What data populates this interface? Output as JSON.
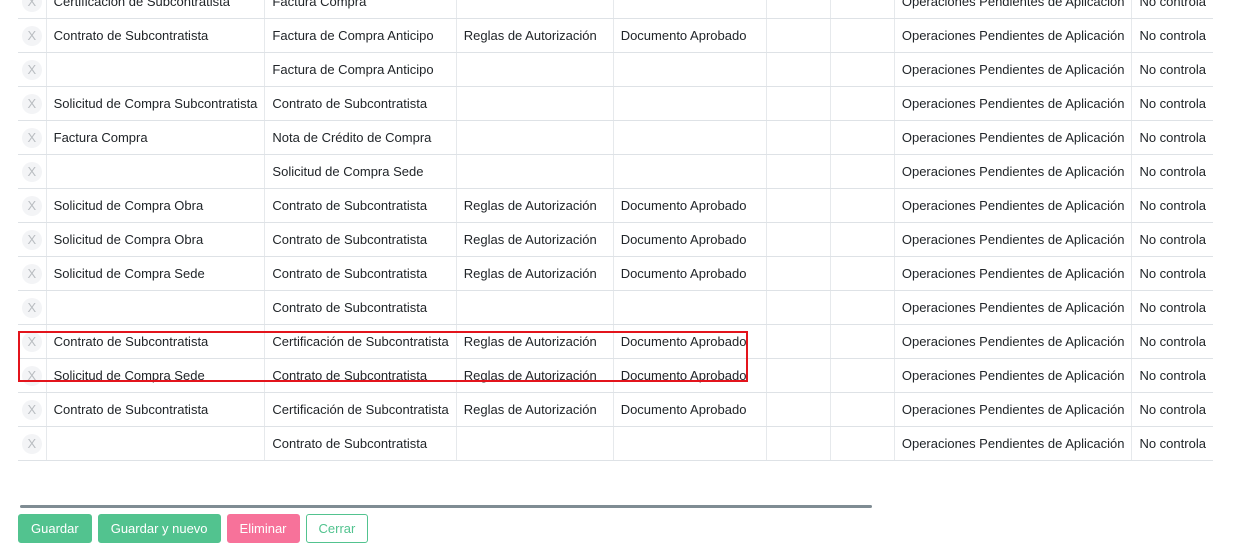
{
  "colors": {
    "primary": "#52c38f",
    "danger": "#f7729a",
    "highlight": "#e3141c"
  },
  "icons": {
    "delete": "close-x-icon"
  },
  "grid": {
    "rows": [
      {
        "delete": "X",
        "cells": [
          "Certificación de Subcontratista",
          "Factura Compra",
          "",
          "",
          "",
          "",
          "Operaciones Pendientes de Aplicación",
          "No controla"
        ]
      },
      {
        "delete": "X",
        "cells": [
          "Contrato de Subcontratista",
          "Factura de Compra Anticipo",
          "Reglas de Autorización",
          "Documento Aprobado",
          "",
          "",
          "Operaciones Pendientes de Aplicación",
          "No controla"
        ]
      },
      {
        "delete": "X",
        "cells": [
          "",
          "Factura de Compra Anticipo",
          "",
          "",
          "",
          "",
          "Operaciones Pendientes de Aplicación",
          "No controla"
        ]
      },
      {
        "delete": "X",
        "cells": [
          "Solicitud de Compra Subcontratista",
          "Contrato de Subcontratista",
          "",
          "",
          "",
          "",
          "Operaciones Pendientes de Aplicación",
          "No controla"
        ]
      },
      {
        "delete": "X",
        "cells": [
          "Factura Compra",
          "Nota de Crédito de Compra",
          "",
          "",
          "",
          "",
          "Operaciones Pendientes de Aplicación",
          "No controla"
        ]
      },
      {
        "delete": "X",
        "cells": [
          "",
          "Solicitud de Compra Sede",
          "",
          "",
          "",
          "",
          "Operaciones Pendientes de Aplicación",
          "No controla"
        ]
      },
      {
        "delete": "X",
        "cells": [
          "Solicitud de Compra Obra",
          "Contrato de Subcontratista",
          "Reglas de Autorización",
          "Documento Aprobado",
          "",
          "",
          "Operaciones Pendientes de Aplicación",
          "No controla"
        ]
      },
      {
        "delete": "X",
        "cells": [
          "Solicitud de Compra Obra",
          "Contrato de Subcontratista",
          "Reglas de Autorización",
          "Documento Aprobado",
          "",
          "",
          "Operaciones Pendientes de Aplicación",
          "No controla"
        ]
      },
      {
        "delete": "X",
        "cells": [
          "Solicitud de Compra Sede",
          "Contrato de Subcontratista",
          "Reglas de Autorización",
          "Documento Aprobado",
          "",
          "",
          "Operaciones Pendientes de Aplicación",
          "No controla"
        ]
      },
      {
        "delete": "X",
        "cells": [
          "",
          "Contrato de Subcontratista",
          "",
          "",
          "",
          "",
          "Operaciones Pendientes de Aplicación",
          "No controla"
        ]
      },
      {
        "delete": "X",
        "cells": [
          "Contrato de Subcontratista",
          "Certificación de Subcontratista",
          "Reglas de Autorización",
          "Documento Aprobado",
          "",
          "",
          "Operaciones Pendientes de Aplicación",
          "No controla"
        ]
      },
      {
        "delete": "X",
        "cells": [
          "Solicitud de Compra Sede",
          "Contrato de Subcontratista",
          "Reglas de Autorización",
          "Documento Aprobado",
          "",
          "",
          "Operaciones Pendientes de Aplicación",
          "No controla"
        ]
      },
      {
        "delete": "X",
        "cells": [
          "Contrato de Subcontratista",
          "Certificación de Subcontratista",
          "Reglas de Autorización",
          "Documento Aprobado",
          "",
          "",
          "Operaciones Pendientes de Aplicación",
          "No controla"
        ]
      },
      {
        "delete": "X",
        "cells": [
          "",
          "Contrato de Subcontratista",
          "",
          "",
          "",
          "",
          "Operaciones Pendientes de Aplicación",
          "No controla"
        ]
      }
    ]
  },
  "buttons": {
    "save": "Guardar",
    "save_new": "Guardar y nuevo",
    "delete": "Eliminar",
    "close": "Cerrar"
  }
}
